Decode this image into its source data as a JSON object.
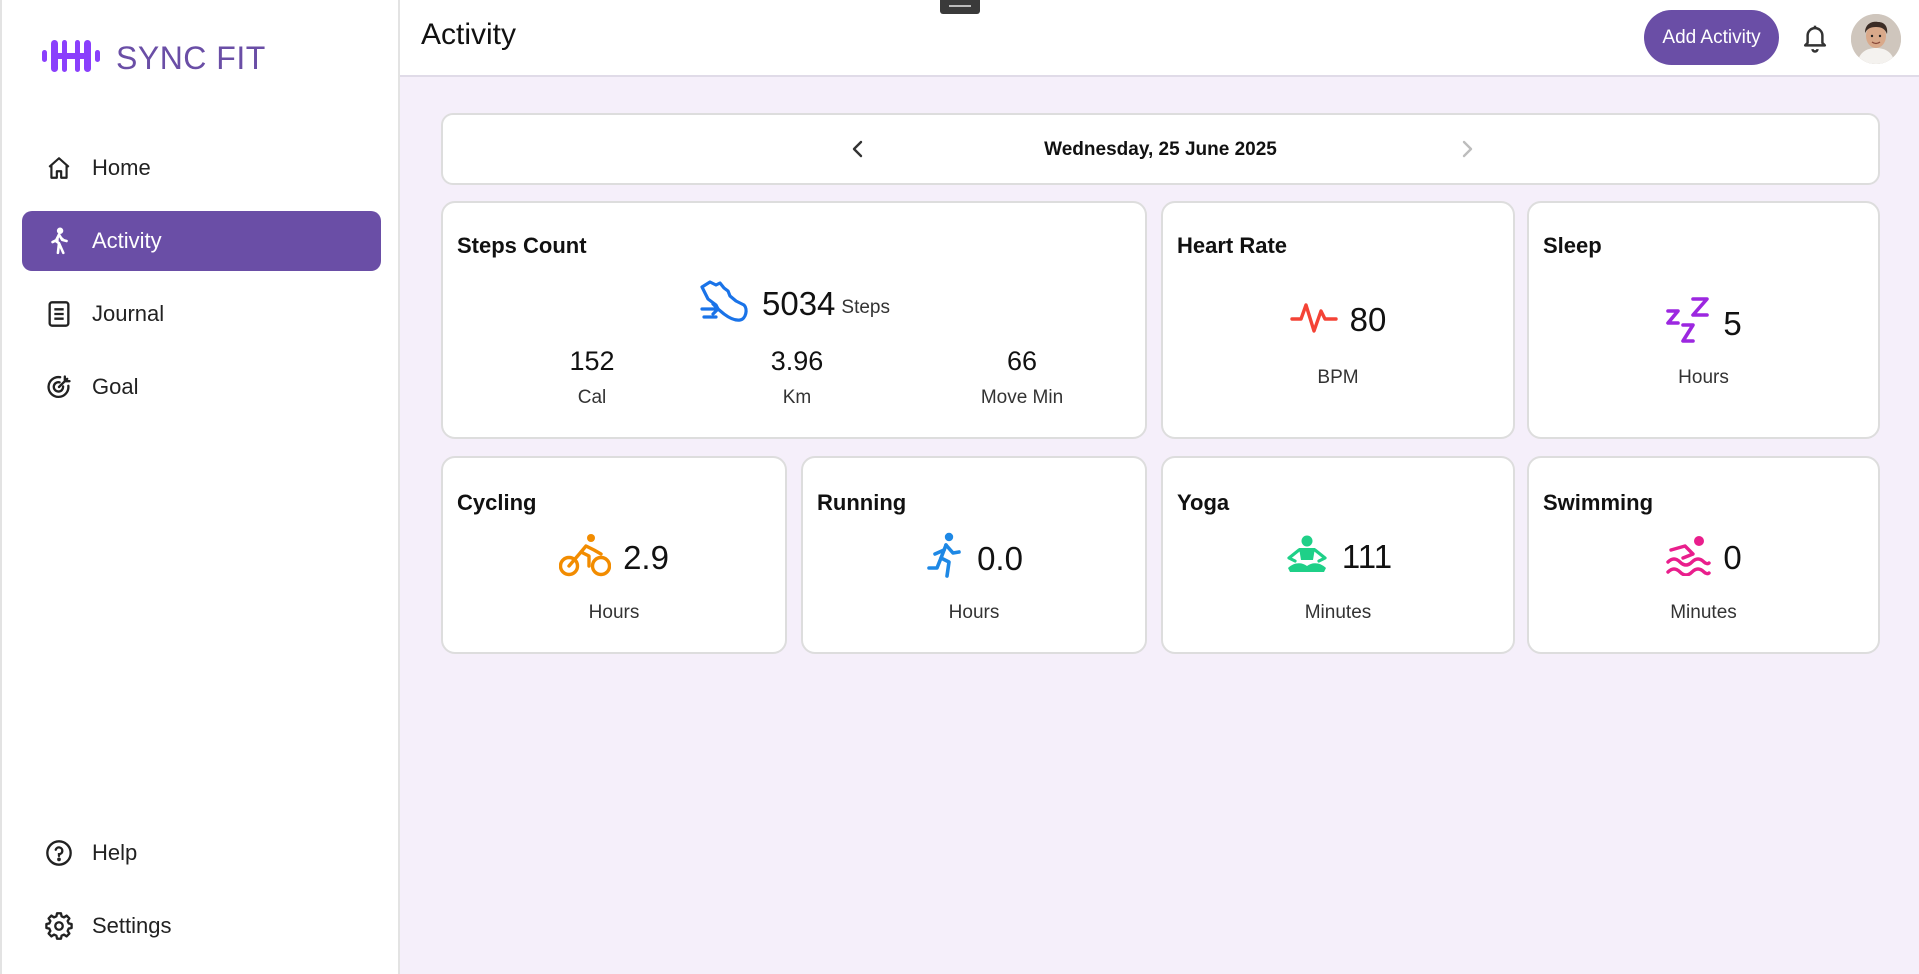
{
  "app": {
    "name": "SYNC FIT",
    "brand_color": "#6a4ea6"
  },
  "sidebar": {
    "items": [
      {
        "label": "Home",
        "icon": "home-icon"
      },
      {
        "label": "Activity",
        "icon": "walking-icon",
        "active": true
      },
      {
        "label": "Journal",
        "icon": "journal-icon"
      },
      {
        "label": "Goal",
        "icon": "goal-icon"
      }
    ],
    "bottom_items": [
      {
        "label": "Help",
        "icon": "help-icon"
      },
      {
        "label": "Settings",
        "icon": "gear-icon"
      }
    ]
  },
  "header": {
    "title": "Activity",
    "add_button": "Add Activity",
    "icons": [
      "bell-icon",
      "avatar"
    ]
  },
  "date_nav": {
    "date": "Wednesday, 25 June 2025"
  },
  "steps": {
    "title": "Steps Count",
    "value": "5034",
    "unit": "Steps",
    "icon_color": "#1a73e8",
    "stats": [
      {
        "value": "152",
        "label": "Cal"
      },
      {
        "value": "3.96",
        "label": "Km"
      },
      {
        "value": "66",
        "label": "Move Min"
      }
    ]
  },
  "heart": {
    "title": "Heart Rate",
    "value": "80",
    "unit": "BPM",
    "icon_color": "#f44336"
  },
  "sleep": {
    "title": "Sleep",
    "value": "5",
    "unit": "Hours",
    "icon_color": "#9c27e0"
  },
  "cycling": {
    "title": "Cycling",
    "value": "2.9",
    "unit": "Hours",
    "icon_color": "#f28c00"
  },
  "running": {
    "title": "Running",
    "value": "0.0",
    "unit": "Hours",
    "icon_color": "#1e88e5"
  },
  "yoga": {
    "title": "Yoga",
    "value": "111",
    "unit": "Minutes",
    "icon_color": "#1fd088"
  },
  "swimming": {
    "title": "Swimming",
    "value": "0",
    "unit": "Minutes",
    "icon_color": "#e91e8c"
  }
}
